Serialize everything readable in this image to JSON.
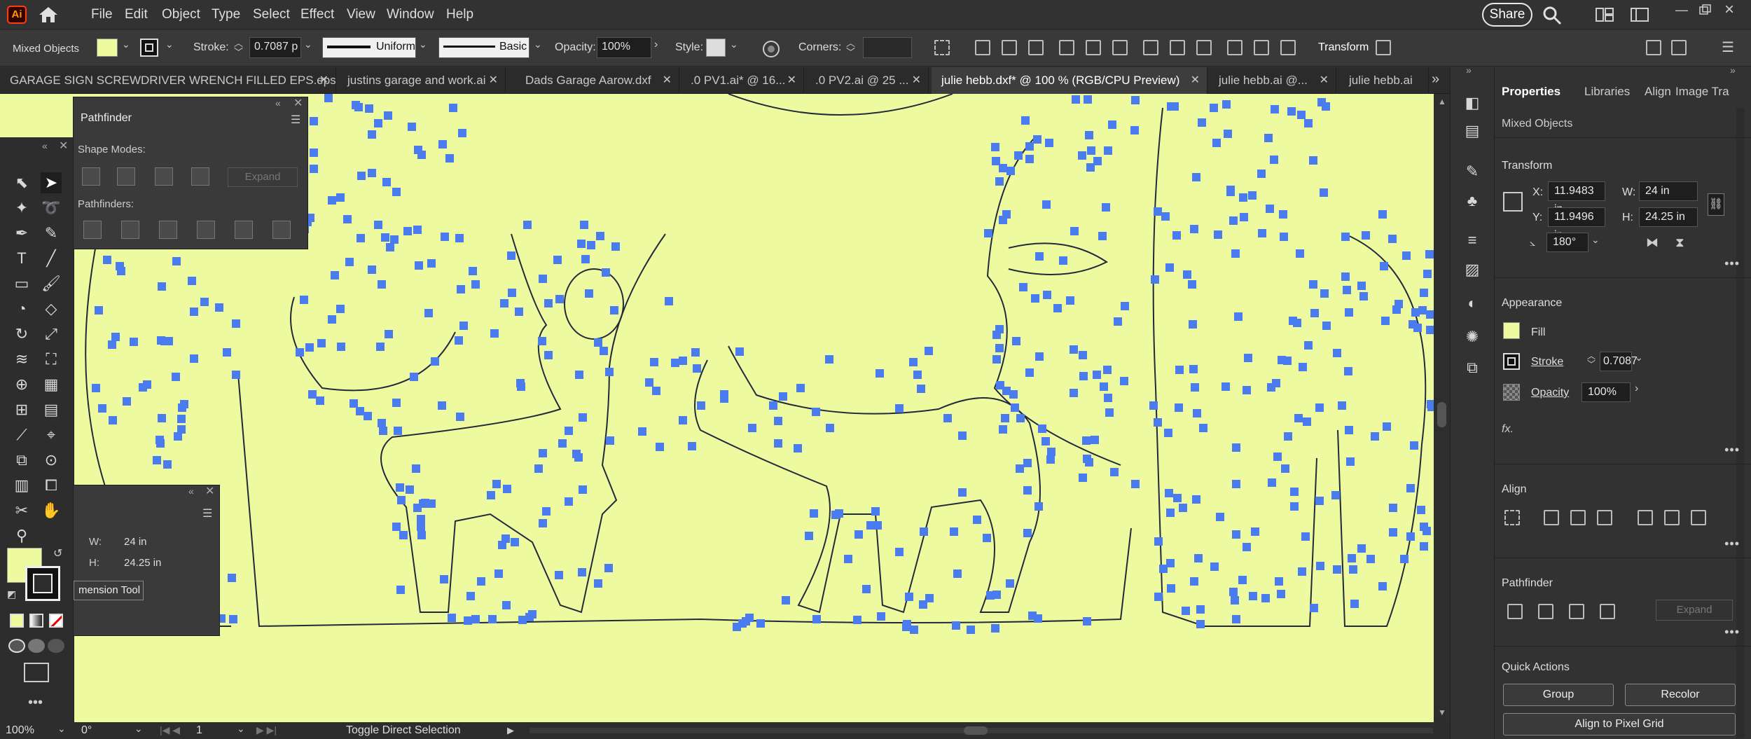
{
  "app": {
    "logo": "Ai",
    "share": "Share"
  },
  "menu": [
    "File",
    "Edit",
    "Object",
    "Type",
    "Select",
    "Effect",
    "View",
    "Window",
    "Help"
  ],
  "control": {
    "selection": "Mixed Objects",
    "stroke_label": "Stroke:",
    "stroke_value": "0.7087 p",
    "profile": "Uniform",
    "brush": "Basic",
    "opacity_label": "Opacity:",
    "opacity_value": "100%",
    "style_label": "Style:",
    "corners_label": "Corners:",
    "transform": "Transform"
  },
  "tabs": [
    {
      "label": "GARAGE SIGN SCREWDRIVER WRENCH FILLED EPS.eps*"
    },
    {
      "label": "justins garage and work.ai"
    },
    {
      "label": "Dads Garage Aarow.dxf"
    },
    {
      "label": ".0 PV1.ai* @ 16..."
    },
    {
      "label": ".0 PV2.ai @ 25 ..."
    },
    {
      "label": "julie hebb.dxf* @ 100 % (RGB/CPU Preview)"
    },
    {
      "label": "julie hebb.ai @..."
    },
    {
      "label": "julie hebb.ai"
    }
  ],
  "pathfinder": {
    "title": "Pathfinder",
    "shape_modes": "Shape Modes:",
    "expand": "Expand",
    "pathfinders": "Pathfinders:"
  },
  "mini_panel": {
    "w_label": "W:",
    "w_value": "24 in",
    "h_label": "H:",
    "h_value": "24.25 in",
    "tool_button": "mension Tool"
  },
  "status": {
    "zoom": "100%",
    "rotate": "0°",
    "artboard": "1",
    "message": "Toggle Direct Selection"
  },
  "properties": {
    "tabs": [
      "Properties",
      "Libraries",
      "Align",
      "Image Tra"
    ],
    "selection": "Mixed Objects",
    "transform": {
      "title": "Transform",
      "x_label": "X:",
      "x": "11.9483 in",
      "y_label": "Y:",
      "y": "11.9496 in",
      "w_label": "W:",
      "w": "24 in",
      "h_label": "H:",
      "h": "24.25 in",
      "angle": "180°"
    },
    "appearance": {
      "title": "Appearance",
      "fill": "Fill",
      "stroke": "Stroke",
      "stroke_value": "0.7087",
      "opacity": "Opacity",
      "opacity_value": "100%"
    },
    "align": {
      "title": "Align"
    },
    "pathfinder": {
      "title": "Pathfinder",
      "expand": "Expand"
    },
    "quick_actions": {
      "title": "Quick Actions",
      "group": "Group",
      "recolor": "Recolor",
      "align_pixel": "Align to Pixel Grid"
    }
  },
  "colors": {
    "canvas": "#eefaa0",
    "anchor": "#4a7cf0",
    "fill_swatch": "#eefaa0"
  }
}
